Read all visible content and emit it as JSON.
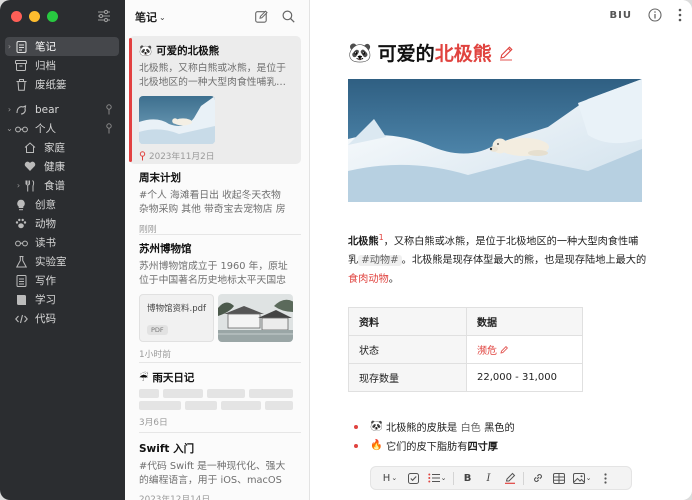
{
  "sidebar": {
    "items": [
      {
        "label": "笔记",
        "icon": "note-icon"
      },
      {
        "label": "归档",
        "icon": "archive-icon"
      },
      {
        "label": "废纸篓",
        "icon": "trash-icon"
      },
      {
        "label": "bear",
        "icon": "bear-icon"
      },
      {
        "label": "个人",
        "icon": "glasses-icon"
      },
      {
        "label": "家庭",
        "icon": "home-icon"
      },
      {
        "label": "健康",
        "icon": "heart-icon"
      },
      {
        "label": "食谱",
        "icon": "fork-icon"
      },
      {
        "label": "创意",
        "icon": "bulb-icon"
      },
      {
        "label": "动物",
        "icon": "paw-icon"
      },
      {
        "label": "读书",
        "icon": "glasses-icon"
      },
      {
        "label": "实验室",
        "icon": "flask-icon"
      },
      {
        "label": "写作",
        "icon": "doc-icon"
      },
      {
        "label": "学习",
        "icon": "book-icon"
      },
      {
        "label": "代码",
        "icon": "code-icon"
      }
    ]
  },
  "list": {
    "title": "笔记",
    "notes": [
      {
        "title": "可爱的北极熊",
        "emoji": "🐼",
        "body": "北极熊，又称白熊或冰熊，是位于北极地区的一种大型肉食性哺乳…",
        "date": "2023年11月2日"
      },
      {
        "title": "周末计划",
        "body": "#个人 海滩看日出 收起冬天衣物 杂物采购 其他 带奇宝去宠物店 房屋…",
        "date": "刚刚"
      },
      {
        "title": "苏州博物馆",
        "body": "苏州博物馆成立于 1960 年，原址位于中国著名历史地标太平天国忠王…",
        "attachment": "博物馆资料.pdf",
        "attachment_tag": "PDF",
        "date": "1小时前"
      },
      {
        "title": "雨天日记",
        "emoji": "☔",
        "date": "3月6日"
      },
      {
        "title": "Swift 入门",
        "body": "#代码 Swift 是一种现代化、强大的编程语言，用于 iOS、macOS 等…",
        "date": "2023年12月14日"
      }
    ]
  },
  "editor": {
    "format_label": "BIU",
    "title_emoji": "🐼",
    "title_prefix": "可爱的",
    "title_accent": "北极熊",
    "para": {
      "bold": "北极熊",
      "sup": "1",
      "text1": "，又称白熊或冰熊，是位于北极地区的一种大型肉食性哺乳",
      "tag": "#动物#",
      "text2": "。北极熊是现存体型最大的熊，也是现存陆地上最大的",
      "link": "食肉动物",
      "end": "。"
    },
    "table": {
      "headers": [
        "资料",
        "数据"
      ],
      "rows": [
        [
          "状态",
          "濒危"
        ],
        [
          "现存数量",
          "22,000 - 31,000"
        ]
      ]
    },
    "bullets": [
      {
        "emoji": "🐼",
        "pre": "北极熊的皮肤是",
        "muted": "白色",
        "post": "黑色的"
      },
      {
        "emoji": "🔥",
        "pre": "它们的皮下脂肪有",
        "bold": "四寸厚",
        "post": ""
      }
    ],
    "bottom_toolbar": [
      "H",
      "B",
      "I"
    ]
  },
  "colors": {
    "accent": "#e0433f",
    "sidebar_bg": "#2b2d30"
  }
}
